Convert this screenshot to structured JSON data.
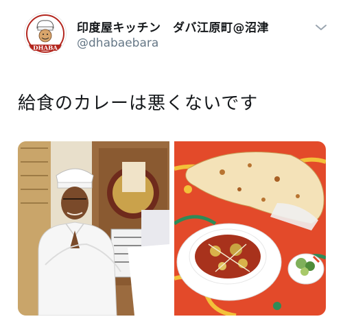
{
  "tweet": {
    "author": {
      "display_name": "印度屋キッチン　ダバ江原町@沼津",
      "handle": "@dhabaebara",
      "avatar_text": "DHABA"
    },
    "text": "給食のカレーは悪くないです",
    "menu_icon": "chevron-down-icon",
    "photos": [
      {
        "alt": "chef-photo"
      },
      {
        "alt": "curry-and-naan-photo"
      }
    ]
  },
  "colors": {
    "text_primary": "#14171a",
    "text_secondary": "#657786",
    "logo_red": "#b3261e"
  }
}
